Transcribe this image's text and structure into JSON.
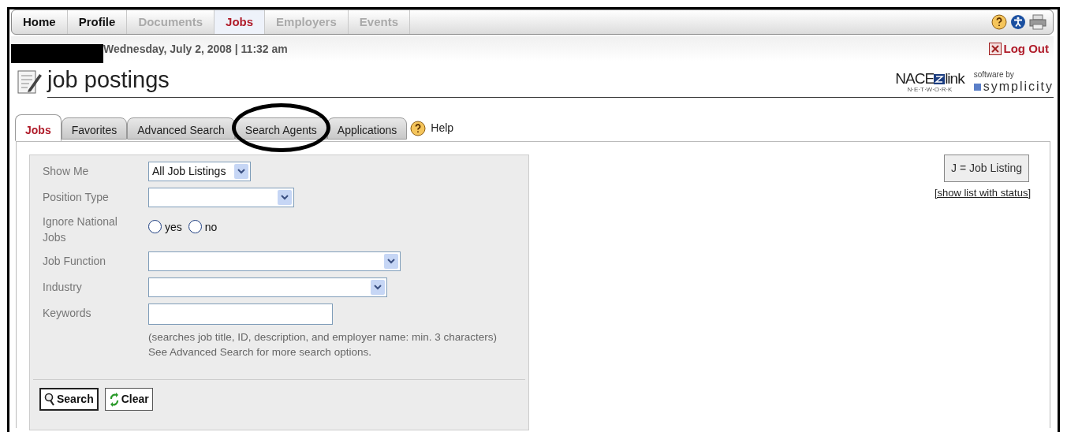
{
  "nav_tabs": [
    {
      "label": "Home",
      "selected": false,
      "disabled": false
    },
    {
      "label": "Profile",
      "selected": false,
      "disabled": false
    },
    {
      "label": "Documents",
      "selected": false,
      "disabled": true
    },
    {
      "label": "Jobs",
      "selected": true,
      "disabled": false
    },
    {
      "label": "Employers",
      "selected": false,
      "disabled": true
    },
    {
      "label": "Events",
      "selected": false,
      "disabled": true
    }
  ],
  "user_bar": {
    "date_time": "Wednesday, July 2, 2008 | 11:32 am",
    "logout": "Log Out"
  },
  "page_title": "job postings",
  "logos": {
    "nace": "NACE",
    "link": "link",
    "network": "N·E·T·W·O·R·K",
    "software_by": "software by",
    "symplicity": "symplicity"
  },
  "sub_tabs": [
    {
      "label": "Jobs",
      "selected": true
    },
    {
      "label": "Favorites",
      "selected": false
    },
    {
      "label": "Advanced Search",
      "selected": false
    },
    {
      "label": "Search Agents",
      "selected": false
    },
    {
      "label": "Applications",
      "selected": false
    }
  ],
  "help_link": "Help",
  "form": {
    "fields": [
      {
        "kind": "select",
        "label": "Show Me",
        "value": "All Job Listings"
      },
      {
        "kind": "select",
        "label": "Position Type"
      },
      {
        "kind": "radio",
        "label": "Ignore National Jobs",
        "options": [
          {
            "label": "yes",
            "selected": false
          },
          {
            "label": "no",
            "selected": false
          }
        ]
      },
      {
        "kind": "select",
        "label": "Job Function"
      },
      {
        "kind": "select",
        "label": "Industry"
      },
      {
        "kind": "text",
        "label": "Keywords",
        "notes": [
          "(searches job title, ID, description, and employer name: min. 3 characters)",
          "See Advanced Search for more search options."
        ]
      }
    ],
    "buttons": [
      {
        "kind": "search",
        "label": "Search"
      },
      {
        "kind": "clear",
        "label": "Clear"
      }
    ]
  },
  "legend": {
    "text": "J = Job Listing",
    "link": "[show list with status]"
  }
}
